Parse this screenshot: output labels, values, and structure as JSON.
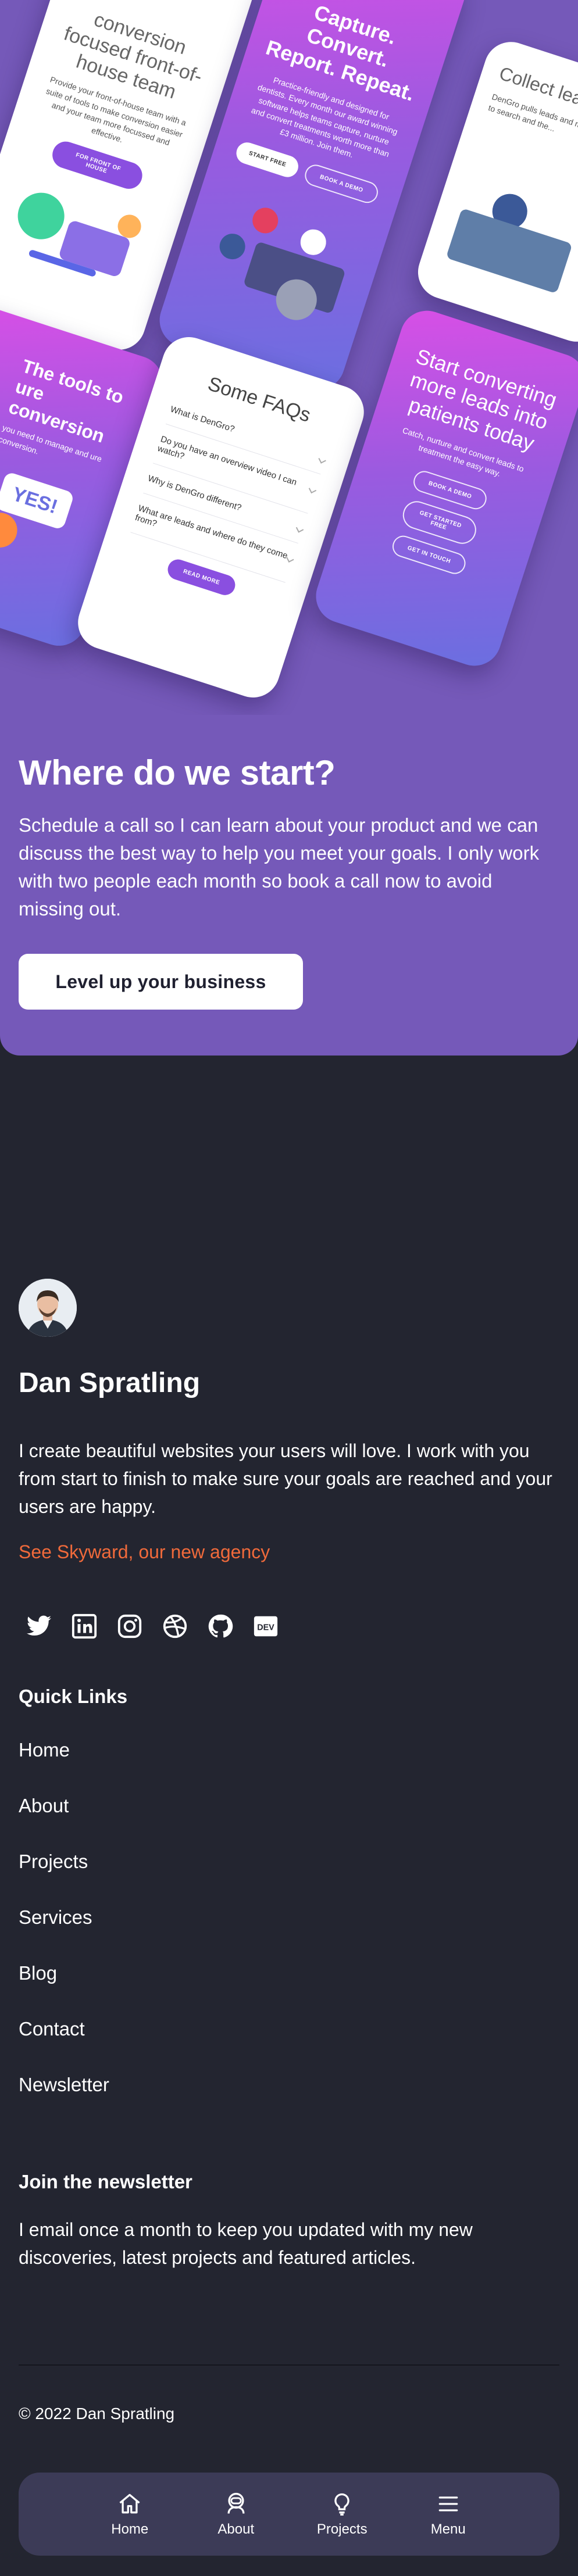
{
  "showcase": {
    "phone_conversion": {
      "title": "conversion focused front-of-house team",
      "text": "Provide your front-of-house team with a suite of tools to make conversion easier and your team more focussed and effective.",
      "button": "FOR FRONT OF HOUSE"
    },
    "phone_capture": {
      "title": "Capture. Convert. Report. Repeat.",
      "text": "Practice-friendly and designed for dentists. Every month our award winning software helps teams capture, nurture and convert treatments worth more than £3 million. Join them.",
      "button_primary": "START FREE",
      "button_secondary": "BOOK A DEMO"
    },
    "phone_collect": {
      "title": "Collect leads",
      "text": "DenGro pulls leads and marketing activity to search and the..."
    },
    "phone_tools": {
      "title": "The tools to ure conversion",
      "text": "you need to manage and ure conversion.",
      "badge": "YES!"
    },
    "phone_faq": {
      "title": "Some FAQs",
      "items": [
        "What is DenGro?",
        "Do you have an overview video I can watch?",
        "Why is DenGro different?",
        "What are leads and where do they come from?"
      ],
      "button": "READ MORE"
    },
    "phone_start": {
      "title": "Start converting more leads into patients today",
      "text": "Catch, nurture and convert leads to treatment the easy way.",
      "buttons": [
        "BOOK A DEMO",
        "GET STARTED FREE",
        "GET IN TOUCH"
      ]
    }
  },
  "start": {
    "title": "Where do we start?",
    "text": "Schedule a call so I can learn about your product and we can discuss the best way to help you meet your goals. I only work with two people each month so book a call now to avoid missing out.",
    "cta": "Level up your business"
  },
  "profile": {
    "name": "Dan Spratling",
    "bio": "I create beautiful websites your users will love. I work with you from start to finish to make sure your goals are reached and your users are happy.",
    "agency_link": "See Skyward, our new agency",
    "link_color": "#f06a3b"
  },
  "socials": [
    {
      "icon": "twitter-icon"
    },
    {
      "icon": "linkedin-icon"
    },
    {
      "icon": "instagram-icon"
    },
    {
      "icon": "dribbble-icon"
    },
    {
      "icon": "github-icon"
    },
    {
      "icon": "dev-icon",
      "label": "DEV"
    }
  ],
  "quick_links": {
    "title": "Quick Links",
    "items": [
      "Home",
      "About",
      "Projects",
      "Services",
      "Blog",
      "Contact",
      "Newsletter"
    ]
  },
  "newsletter": {
    "title": "Join the newsletter",
    "text": "I email once a month to keep you updated with my new discoveries, latest projects and featured articles."
  },
  "footer": {
    "copyright": "© 2022 Dan Spratling"
  },
  "bottom_nav": {
    "items": [
      {
        "label": "Home",
        "icon": "home-icon"
      },
      {
        "label": "About",
        "icon": "astronaut-icon"
      },
      {
        "label": "Projects",
        "icon": "lightbulb-icon"
      },
      {
        "label": "Menu",
        "icon": "hamburger-icon"
      }
    ]
  },
  "colors": {
    "page_bg": "#232530",
    "hero_bg": "#7559b9",
    "nav_bg": "#3c3b57",
    "accent": "#f06a3b"
  }
}
